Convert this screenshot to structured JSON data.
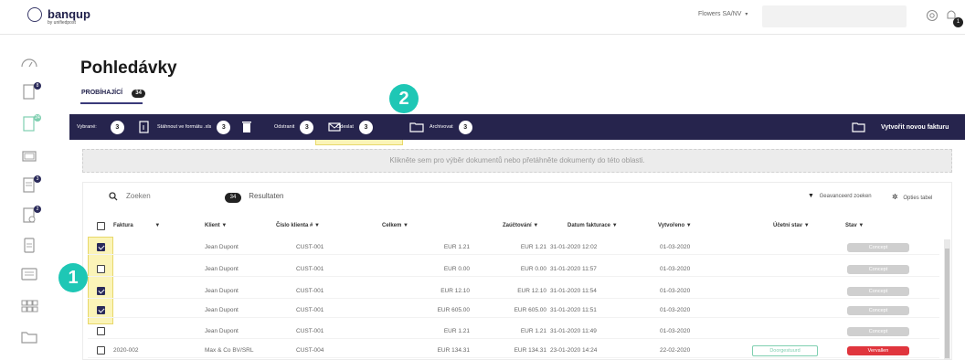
{
  "header": {
    "logo_text": "banqup",
    "logo_sub": "by unifiedpost",
    "company": "Flowers SA/NV",
    "company_caret": "▾",
    "notif_count": "1"
  },
  "sidebar": {
    "badges": [
      "8",
      "24",
      "3",
      "2",
      "3"
    ]
  },
  "page": {
    "title": "Pohledávky",
    "tab_label": "PROBÍHAJÍCÍ",
    "tab_count": "34"
  },
  "actionbar": {
    "selected_label": "Vybrané:",
    "selected_count": "3",
    "download_label": "Stáhnout ve formátu .xls",
    "download_count": "3",
    "delete_label": "Odstranit",
    "delete_count": "3",
    "send_label": "Odeslat",
    "send_count": "3",
    "archive_label": "Archivovat",
    "archive_count": "3",
    "create_label": "Vytvořit novou fakturu"
  },
  "annotations": {
    "badge1": "1",
    "badge2": "2"
  },
  "dropzone": {
    "text": "Klikněte sem pro výběr dokumentů nebo přetáhněte dokumenty do této oblasti."
  },
  "table": {
    "search_placeholder": "Zoeken",
    "results_count": "34",
    "results_label": "Resultaten",
    "adv_search": "Geavanceerd zoeken",
    "opts_table": "Opties tabel",
    "columns": [
      "Faktura",
      "Klient",
      "Číslo klienta #",
      "Celkem",
      "Zaúčtování",
      "Datum fakturace",
      "Vytvořeno",
      "Účetní stav",
      "Stav"
    ],
    "rows": [
      {
        "checked": true,
        "faktura": "",
        "klient": "Jean Dupont",
        "cislo": "CUST-001",
        "celkem": "EUR 1.21",
        "zauct": "EUR 1.21",
        "datum": "31-01-2020 12:02",
        "vytvoreno": "01-03-2020",
        "ucetni": "",
        "stav": "Concept",
        "stav_type": "grey"
      },
      {
        "checked": false,
        "faktura": "",
        "klient": "Jean Dupont",
        "cislo": "CUST-001",
        "celkem": "EUR 0.00",
        "zauct": "EUR 0.00",
        "datum": "31-01-2020 11:57",
        "vytvoreno": "01-03-2020",
        "ucetni": "",
        "stav": "Concept",
        "stav_type": "grey"
      },
      {
        "checked": true,
        "faktura": "",
        "klient": "Jean Dupont",
        "cislo": "CUST-001",
        "celkem": "EUR 12.10",
        "zauct": "EUR 12.10",
        "datum": "31-01-2020 11:54",
        "vytvoreno": "01-03-2020",
        "ucetni": "",
        "stav": "Concept",
        "stav_type": "grey"
      },
      {
        "checked": true,
        "faktura": "",
        "klient": "Jean Dupont",
        "cislo": "CUST-001",
        "celkem": "EUR 605.00",
        "zauct": "EUR 605.00",
        "datum": "31-01-2020 11:51",
        "vytvoreno": "01-03-2020",
        "ucetni": "",
        "stav": "Concept",
        "stav_type": "grey"
      },
      {
        "checked": false,
        "faktura": "",
        "klient": "Jean Dupont",
        "cislo": "CUST-001",
        "celkem": "EUR 1.21",
        "zauct": "EUR 1.21",
        "datum": "31-01-2020 11:49",
        "vytvoreno": "01-03-2020",
        "ucetni": "",
        "stav": "Concept",
        "stav_type": "grey"
      },
      {
        "checked": false,
        "faktura": "2020-002",
        "klient": "Max & Co BV/SRL",
        "cislo": "CUST-004",
        "celkem": "EUR 134.31",
        "zauct": "EUR 134.31",
        "datum": "23-01-2020 14:24",
        "vytvoreno": "22-02-2020",
        "ucetni": "Doorgestuurd",
        "stav": "Vervallen",
        "stav_type": "red"
      }
    ]
  },
  "colors": {
    "actionbar": "#26244d",
    "accent_teal": "#1ec7b5",
    "highlight": "#fbf4b8",
    "status_red": "#e0353d"
  }
}
